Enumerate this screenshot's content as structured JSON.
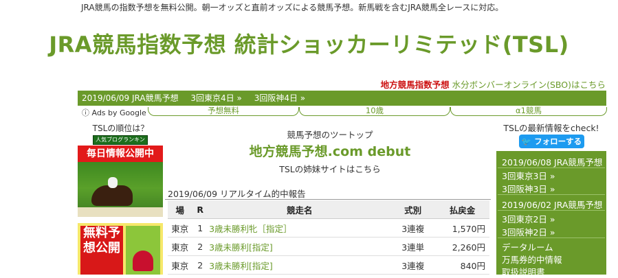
{
  "header": {
    "tagline": "JRA競馬の指数予想を無料公開。朝一オッズと直前オッズによる競馬予想。新馬戦を含むJRA競馬全レースに対応。",
    "title": "JRA競馬指数予想 統計ショッカーリミテッド(TSL)",
    "link_red": "地方競馬指数予想",
    "link_green": "水分ボンバーオンライン(SBO)はこちら"
  },
  "nav": {
    "date": "2019/06/09 JRA競馬予想",
    "items": [
      "3回東京4日 »",
      "3回阪神4日 »"
    ]
  },
  "ads": {
    "label": "ⓘ Ads by Google",
    "tabs": [
      "予想無料",
      "10歳",
      "α1競馬"
    ]
  },
  "left": {
    "rank_label": "TSLの順位は？",
    "badge": "人気ブログランキング",
    "banner1_header": "毎日情報公開中",
    "banner2_text": "無料予想公開"
  },
  "center": {
    "tag": "競馬予想のツートップ",
    "link": "地方競馬予想.com debut",
    "sub": "TSLの姉妹サイトはこちら",
    "report_title": "2019/06/09 リアルタイム的中報告",
    "columns": [
      "場",
      "R",
      "競走名",
      "式別",
      "払戻金"
    ],
    "rows": [
      [
        "東京",
        "1",
        "3歳未勝利牝［指定］",
        "3連複",
        "1,570円"
      ],
      [
        "東京",
        "2",
        "3歳未勝利[指定]",
        "3連単",
        "2,260円"
      ],
      [
        "東京",
        "2",
        "3歳未勝利[指定]",
        "3連複",
        "840円"
      ]
    ]
  },
  "right": {
    "info": "TSLの最新情報をcheck!",
    "follow": "フォローする",
    "sections": [
      {
        "title": "2019/06/08 JRA競馬予想",
        "items": [
          "3回東京3日 »",
          "3回阪神3日 »"
        ]
      },
      {
        "title": "2019/06/02 JRA競馬予想",
        "items": [
          "3回東京2日 »",
          "3回阪神2日 »"
        ]
      }
    ],
    "links": [
      "データルーム",
      "万馬券的中情報",
      "取扱説明書"
    ]
  }
}
